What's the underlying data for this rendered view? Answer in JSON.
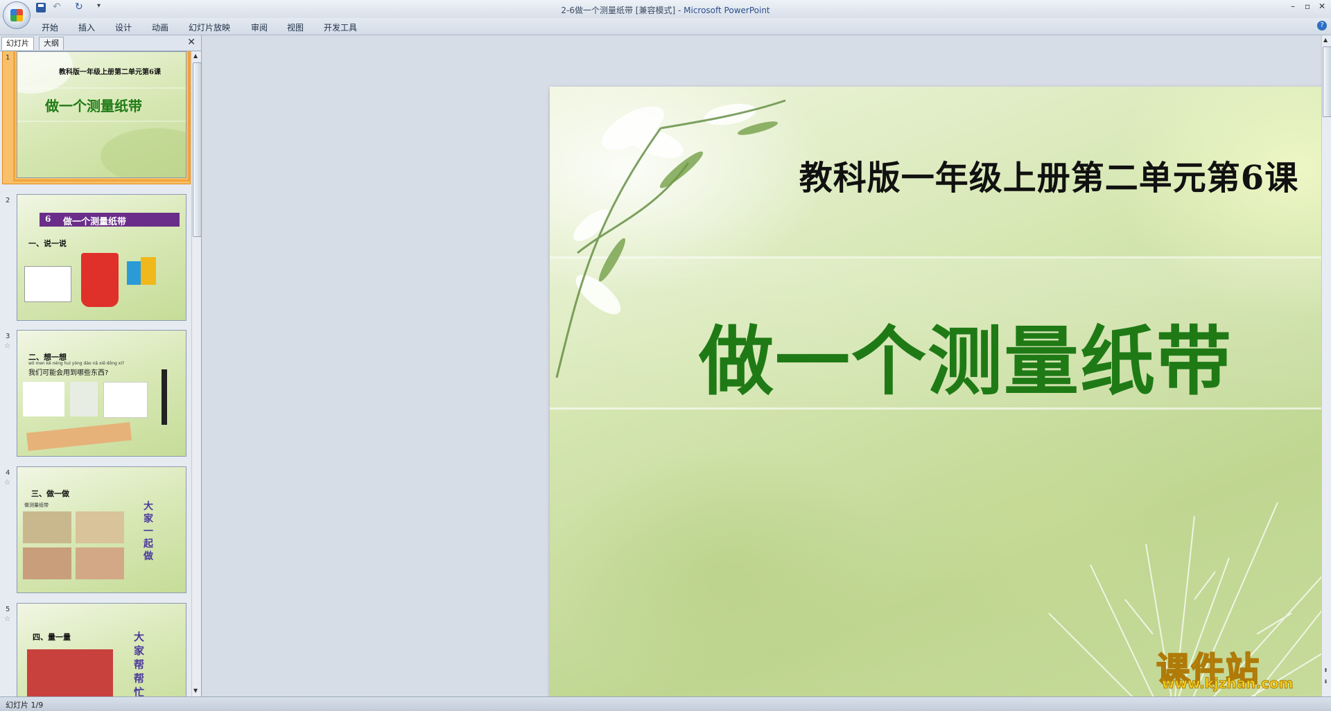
{
  "window": {
    "title_doc": "2-6做一个测量纸带 [兼容模式] - ",
    "title_app": "Microsoft PowerPoint",
    "minimize": "–",
    "maximize": "▫",
    "close": "✕"
  },
  "qat": {
    "more": "▾"
  },
  "ribbon": {
    "tabs": [
      "开始",
      "插入",
      "设计",
      "动画",
      "幻灯片放映",
      "审阅",
      "视图",
      "开发工具"
    ],
    "help": "?"
  },
  "pane": {
    "tab_slides": "幻灯片",
    "tab_outline": "大纲",
    "close": "✕"
  },
  "thumbnails": [
    {
      "num": "1",
      "line1": "教科版一年级上册第二单元第6课",
      "line2": "做一个测量纸带"
    },
    {
      "num": "2",
      "header": "做一个测量纸带",
      "badge": "6",
      "section": "一、说一说"
    },
    {
      "num": "3",
      "section": "二、想一想",
      "pinyin": "wǒ men kě néng huì yòng dào nǎ xiē dōng xi?",
      "question": "我们可能会用到哪些东西?"
    },
    {
      "num": "4",
      "section": "三、做一做",
      "side": "大家一起做",
      "caption": "做测量纸带"
    },
    {
      "num": "5",
      "section": "四、量一量",
      "side": "大家帮帮忙"
    }
  ],
  "slide": {
    "subtitle": "教科版一年级上册第二单元第6课",
    "title": "做一个测量纸带"
  },
  "watermark": {
    "cn": "课件站",
    "url": "www.kjzhan.com"
  },
  "status": {
    "text": "幻灯片 1/9"
  },
  "colors": {
    "slide_title": "#1f7a16",
    "selection": "#f2a53a",
    "watermark": "#f1d21c"
  }
}
